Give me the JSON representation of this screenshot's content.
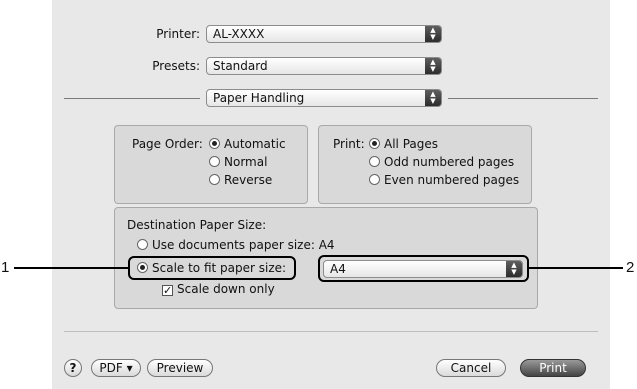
{
  "printer": {
    "label": "Printer:",
    "value": "AL-XXXX"
  },
  "presets": {
    "label": "Presets:",
    "value": "Standard"
  },
  "panel": {
    "value": "Paper Handling"
  },
  "page_order": {
    "label": "Page Order:",
    "options": [
      "Automatic",
      "Normal",
      "Reverse"
    ],
    "selected": "Automatic"
  },
  "print": {
    "label": "Print:",
    "options": [
      "All Pages",
      "Odd numbered pages",
      "Even numbered pages"
    ],
    "selected": "All Pages"
  },
  "destination": {
    "heading": "Destination Paper Size:",
    "use_documents_label": "Use documents paper size:",
    "use_documents_value": "A4",
    "scale_label": "Scale to fit paper size:",
    "paper_size_value": "A4",
    "scale_down_label": "Scale down only",
    "scale_down_checked": true
  },
  "callouts": {
    "one": "1",
    "two": "2"
  },
  "buttons": {
    "help": "?",
    "pdf": "PDF ▾",
    "preview": "Preview",
    "cancel": "Cancel",
    "print": "Print"
  }
}
